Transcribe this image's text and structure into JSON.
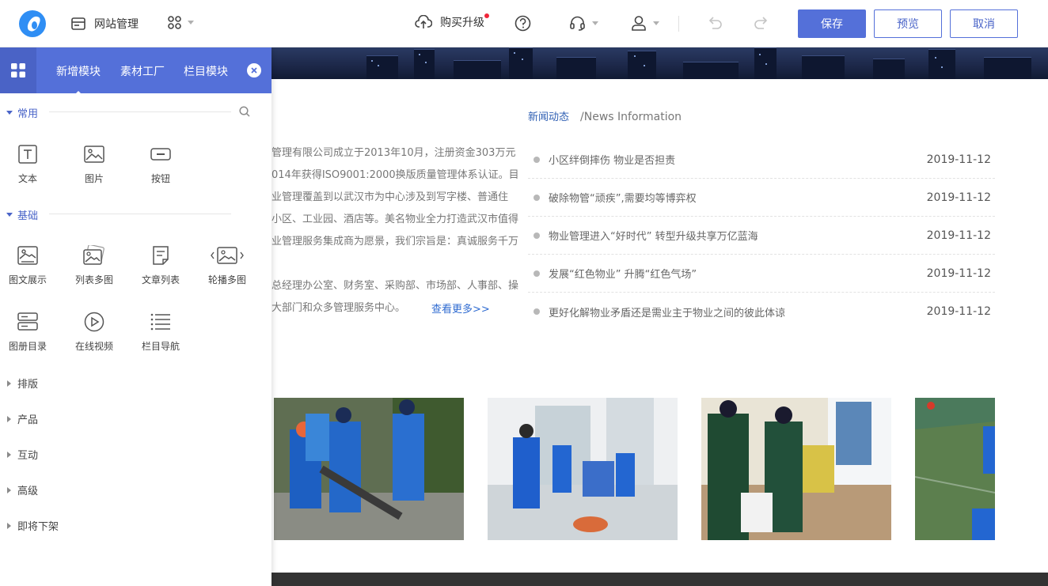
{
  "topbar": {
    "site_management_label": "网站管理",
    "upgrade_label": "购买升级",
    "save_label": "保存",
    "preview_label": "预览",
    "cancel_label": "取消"
  },
  "panel": {
    "tabs": [
      {
        "label": "新增模块"
      },
      {
        "label": "素材工厂"
      },
      {
        "label": "栏目模块"
      }
    ],
    "sections": [
      {
        "label": "常用",
        "items": [
          {
            "label": "文本",
            "icon": "text-icon"
          },
          {
            "label": "图片",
            "icon": "image-icon"
          },
          {
            "label": "按钮",
            "icon": "button-icon"
          }
        ]
      },
      {
        "label": "基础",
        "items": [
          {
            "label": "图文展示",
            "icon": "image-text-icon"
          },
          {
            "label": "列表多图",
            "icon": "multi-image-icon"
          },
          {
            "label": "文章列表",
            "icon": "article-list-icon"
          },
          {
            "label": "轮播多图",
            "icon": "carousel-icon"
          },
          {
            "label": "图册目录",
            "icon": "album-icon"
          },
          {
            "label": "在线视频",
            "icon": "video-icon"
          },
          {
            "label": "栏目导航",
            "icon": "nav-list-icon"
          }
        ]
      },
      {
        "label": "排版"
      },
      {
        "label": "产品"
      },
      {
        "label": "互动"
      },
      {
        "label": "高级"
      },
      {
        "label": "即将下架"
      }
    ]
  },
  "page": {
    "about_lines": [
      "管理有限公司成立于2013年10月，注册资金303万元",
      "014年获得ISO9001:2000换版质量管理体系认证。目",
      "业管理覆盖到以武汉市为中心涉及到写字楼、普通住",
      "小区、工业园、酒店等。美名物业全力打造武汉市值得",
      "业管理服务集成商为愿景，我们宗旨是：真诚服务千万",
      "",
      "总经理办公室、财务室、采购部、市场部、人事部、操",
      "大部门和众多管理服务中心。"
    ],
    "more_link": "查看更多>>",
    "news_title_cn": "新闻动态",
    "news_title_en": "/News Information",
    "news": [
      {
        "title": "小区绊倒摔伤 物业是否担责",
        "date": "2019-11-12"
      },
      {
        "title": "破除物管“顽疾”,需要均等博弈权",
        "date": "2019-11-12"
      },
      {
        "title": "物业管理进入“好时代” 转型升级共享万亿蓝海",
        "date": "2019-11-12"
      },
      {
        "title": "发展“红色物业” 升腾“红色气场”",
        "date": "2019-11-12"
      },
      {
        "title": "更好化解物业矛盾还是需业主于物业之间的彼此体谅",
        "date": "2019-11-12"
      }
    ]
  },
  "colors": {
    "accent": "#5470d9",
    "link": "#2f6bd1",
    "notification_dot": "#f0263a"
  }
}
